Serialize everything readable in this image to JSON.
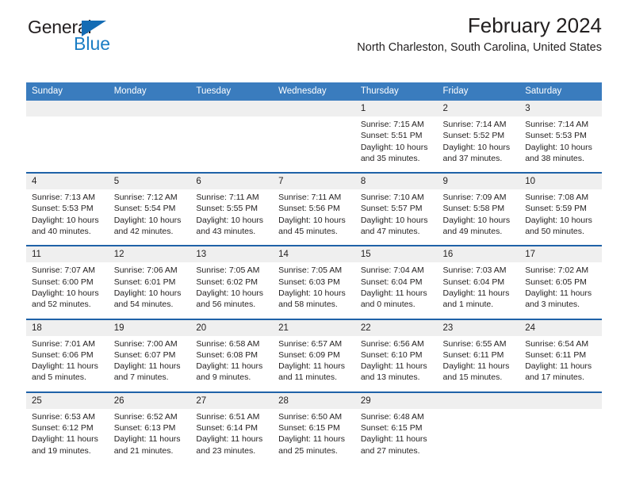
{
  "brand": {
    "name_part1": "General",
    "name_part2": "Blue",
    "triangle_icon": "triangle-icon",
    "colors": {
      "dark": "#231f20",
      "blue": "#1a7dc4",
      "triangle": "#146cb4"
    }
  },
  "header": {
    "title": "February 2024",
    "subtitle": "North Charleston, South Carolina, United States"
  },
  "calendar": {
    "colors": {
      "header_bg": "#3a7cbe",
      "header_text": "#ffffff",
      "week_separator": "#1f62a8",
      "daynum_bg": "#efefef",
      "cell_bg": "#ffffff",
      "text": "#221f1f"
    },
    "weekdays": [
      "Sunday",
      "Monday",
      "Tuesday",
      "Wednesday",
      "Thursday",
      "Friday",
      "Saturday"
    ],
    "weeks": [
      [
        {
          "day": "",
          "lines": []
        },
        {
          "day": "",
          "lines": []
        },
        {
          "day": "",
          "lines": []
        },
        {
          "day": "",
          "lines": []
        },
        {
          "day": "1",
          "lines": [
            "Sunrise: 7:15 AM",
            "Sunset: 5:51 PM",
            "Daylight: 10 hours",
            "and 35 minutes."
          ]
        },
        {
          "day": "2",
          "lines": [
            "Sunrise: 7:14 AM",
            "Sunset: 5:52 PM",
            "Daylight: 10 hours",
            "and 37 minutes."
          ]
        },
        {
          "day": "3",
          "lines": [
            "Sunrise: 7:14 AM",
            "Sunset: 5:53 PM",
            "Daylight: 10 hours",
            "and 38 minutes."
          ]
        }
      ],
      [
        {
          "day": "4",
          "lines": [
            "Sunrise: 7:13 AM",
            "Sunset: 5:53 PM",
            "Daylight: 10 hours",
            "and 40 minutes."
          ]
        },
        {
          "day": "5",
          "lines": [
            "Sunrise: 7:12 AM",
            "Sunset: 5:54 PM",
            "Daylight: 10 hours",
            "and 42 minutes."
          ]
        },
        {
          "day": "6",
          "lines": [
            "Sunrise: 7:11 AM",
            "Sunset: 5:55 PM",
            "Daylight: 10 hours",
            "and 43 minutes."
          ]
        },
        {
          "day": "7",
          "lines": [
            "Sunrise: 7:11 AM",
            "Sunset: 5:56 PM",
            "Daylight: 10 hours",
            "and 45 minutes."
          ]
        },
        {
          "day": "8",
          "lines": [
            "Sunrise: 7:10 AM",
            "Sunset: 5:57 PM",
            "Daylight: 10 hours",
            "and 47 minutes."
          ]
        },
        {
          "day": "9",
          "lines": [
            "Sunrise: 7:09 AM",
            "Sunset: 5:58 PM",
            "Daylight: 10 hours",
            "and 49 minutes."
          ]
        },
        {
          "day": "10",
          "lines": [
            "Sunrise: 7:08 AM",
            "Sunset: 5:59 PM",
            "Daylight: 10 hours",
            "and 50 minutes."
          ]
        }
      ],
      [
        {
          "day": "11",
          "lines": [
            "Sunrise: 7:07 AM",
            "Sunset: 6:00 PM",
            "Daylight: 10 hours",
            "and 52 minutes."
          ]
        },
        {
          "day": "12",
          "lines": [
            "Sunrise: 7:06 AM",
            "Sunset: 6:01 PM",
            "Daylight: 10 hours",
            "and 54 minutes."
          ]
        },
        {
          "day": "13",
          "lines": [
            "Sunrise: 7:05 AM",
            "Sunset: 6:02 PM",
            "Daylight: 10 hours",
            "and 56 minutes."
          ]
        },
        {
          "day": "14",
          "lines": [
            "Sunrise: 7:05 AM",
            "Sunset: 6:03 PM",
            "Daylight: 10 hours",
            "and 58 minutes."
          ]
        },
        {
          "day": "15",
          "lines": [
            "Sunrise: 7:04 AM",
            "Sunset: 6:04 PM",
            "Daylight: 11 hours",
            "and 0 minutes."
          ]
        },
        {
          "day": "16",
          "lines": [
            "Sunrise: 7:03 AM",
            "Sunset: 6:04 PM",
            "Daylight: 11 hours",
            "and 1 minute."
          ]
        },
        {
          "day": "17",
          "lines": [
            "Sunrise: 7:02 AM",
            "Sunset: 6:05 PM",
            "Daylight: 11 hours",
            "and 3 minutes."
          ]
        }
      ],
      [
        {
          "day": "18",
          "lines": [
            "Sunrise: 7:01 AM",
            "Sunset: 6:06 PM",
            "Daylight: 11 hours",
            "and 5 minutes."
          ]
        },
        {
          "day": "19",
          "lines": [
            "Sunrise: 7:00 AM",
            "Sunset: 6:07 PM",
            "Daylight: 11 hours",
            "and 7 minutes."
          ]
        },
        {
          "day": "20",
          "lines": [
            "Sunrise: 6:58 AM",
            "Sunset: 6:08 PM",
            "Daylight: 11 hours",
            "and 9 minutes."
          ]
        },
        {
          "day": "21",
          "lines": [
            "Sunrise: 6:57 AM",
            "Sunset: 6:09 PM",
            "Daylight: 11 hours",
            "and 11 minutes."
          ]
        },
        {
          "day": "22",
          "lines": [
            "Sunrise: 6:56 AM",
            "Sunset: 6:10 PM",
            "Daylight: 11 hours",
            "and 13 minutes."
          ]
        },
        {
          "day": "23",
          "lines": [
            "Sunrise: 6:55 AM",
            "Sunset: 6:11 PM",
            "Daylight: 11 hours",
            "and 15 minutes."
          ]
        },
        {
          "day": "24",
          "lines": [
            "Sunrise: 6:54 AM",
            "Sunset: 6:11 PM",
            "Daylight: 11 hours",
            "and 17 minutes."
          ]
        }
      ],
      [
        {
          "day": "25",
          "lines": [
            "Sunrise: 6:53 AM",
            "Sunset: 6:12 PM",
            "Daylight: 11 hours",
            "and 19 minutes."
          ]
        },
        {
          "day": "26",
          "lines": [
            "Sunrise: 6:52 AM",
            "Sunset: 6:13 PM",
            "Daylight: 11 hours",
            "and 21 minutes."
          ]
        },
        {
          "day": "27",
          "lines": [
            "Sunrise: 6:51 AM",
            "Sunset: 6:14 PM",
            "Daylight: 11 hours",
            "and 23 minutes."
          ]
        },
        {
          "day": "28",
          "lines": [
            "Sunrise: 6:50 AM",
            "Sunset: 6:15 PM",
            "Daylight: 11 hours",
            "and 25 minutes."
          ]
        },
        {
          "day": "29",
          "lines": [
            "Sunrise: 6:48 AM",
            "Sunset: 6:15 PM",
            "Daylight: 11 hours",
            "and 27 minutes."
          ]
        },
        {
          "day": "",
          "lines": []
        },
        {
          "day": "",
          "lines": []
        }
      ]
    ]
  }
}
